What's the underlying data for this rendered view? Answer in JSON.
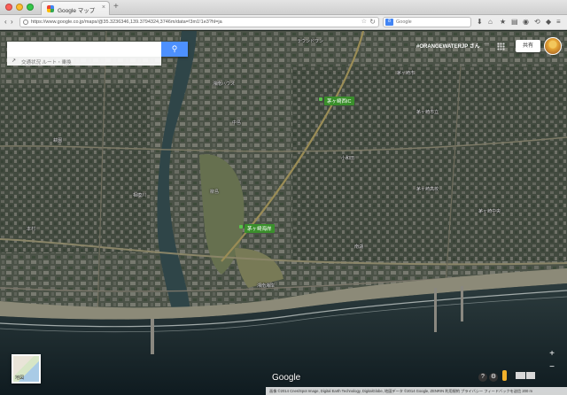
{
  "browser": {
    "tab_title": "Google マップ",
    "tab_close": "×",
    "new_tab": "+",
    "url": "https://www.google.co.jp/maps/@35.3236346,139.3794324,3746m/data=!3m1!1e3?hl=ja",
    "search_engine_letter": "8",
    "search_placeholder": "Google",
    "back": "‹",
    "forward": "›",
    "reload": "↻",
    "star": "☆"
  },
  "map": {
    "search_placeholder": "",
    "route_hint": "交通状況 ルート・乗換",
    "search_icon": "magnifier-icon",
    "share_label": "共有",
    "user_label": "#ORANGEWATERJP さん",
    "user_label2": "···",
    "pins": [
      {
        "label": "茅ヶ崎西IC"
      },
      {
        "label": "茅ヶ崎海岸"
      }
    ],
    "place_labels": [
      "ラウンドワン",
      "茅ヶ崎市",
      "湘南ハウス",
      "茅ヶ崎市立",
      "中島",
      "柳島",
      "萩園",
      "茅ヶ崎中央",
      "相模川",
      "南湖",
      "茅ヶ崎高校",
      "本村",
      "小和田",
      "湘南海岸"
    ],
    "minimap_label": "地図",
    "google_logo": "Google",
    "footer": "画像 ©2014 Cnes/Spot Image, Digital Earth Technology, DigitalGlobe, 地図データ ©2014 Google, ZENRIN   利用規約   プライバシー   フィードバックを送信   200 m",
    "help": "?",
    "settings": "⚙",
    "zoom_in": "+",
    "zoom_out": "−"
  }
}
